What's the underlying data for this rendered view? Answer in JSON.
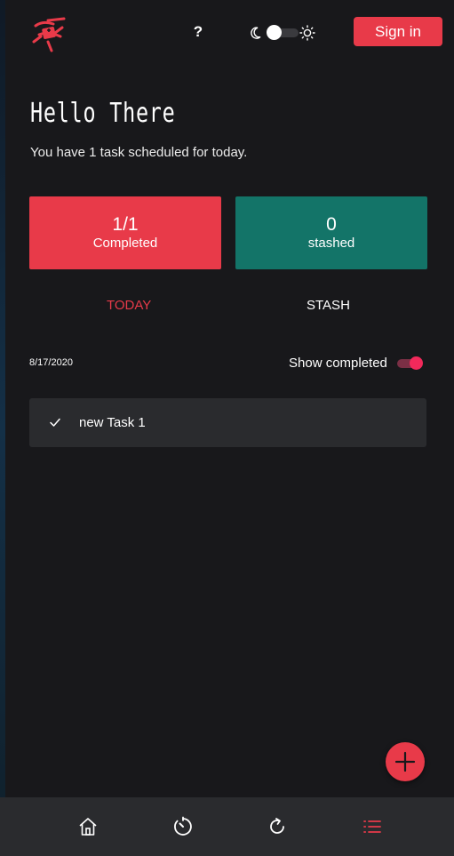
{
  "header": {
    "logo_icon": "swiss-army-knife-logo-icon",
    "help_label": "?",
    "theme_toggle": {
      "left_icon": "moon-icon",
      "right_icon": "sun-icon",
      "mode": "dark"
    },
    "signin_label": "Sign in"
  },
  "greeting": {
    "title": "Hello There",
    "subtitle": "You have 1 task scheduled for today."
  },
  "stats": {
    "completed": {
      "value": "1/1",
      "label": "Completed",
      "color": "#e83a49"
    },
    "stashed": {
      "value": "0",
      "label": "stashed",
      "color": "#137468"
    }
  },
  "tabs": {
    "today": "TODAY",
    "stash": "STASH",
    "active": "today"
  },
  "list": {
    "date": "8/17/2020",
    "show_completed_label": "Show completed",
    "show_completed_on": true,
    "tasks": [
      {
        "label": "new Task 1",
        "completed": true,
        "icon": "check-icon"
      }
    ]
  },
  "fab": {
    "icon": "plus-icon"
  },
  "bottom_nav": {
    "items": [
      {
        "icon": "home-icon",
        "active": false
      },
      {
        "icon": "timer-icon",
        "active": false
      },
      {
        "icon": "repeat-icon",
        "active": false
      },
      {
        "icon": "list-icon",
        "active": true
      }
    ]
  },
  "colors": {
    "background": "#18181b",
    "accent": "#e83a49",
    "teal": "#137468",
    "panel": "#2a2b2e"
  }
}
